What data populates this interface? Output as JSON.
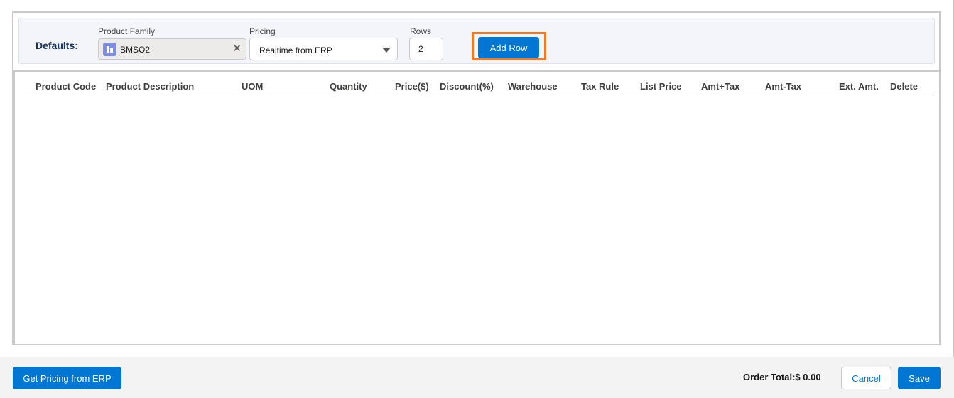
{
  "defaults": {
    "label": "Defaults:",
    "product_family": {
      "label": "Product Family",
      "value": "BMSO2",
      "icon": "product-family-icon",
      "clear_icon": "close-icon"
    },
    "pricing": {
      "label": "Pricing",
      "value": "Realtime from ERP",
      "icon": "chevron-down-icon"
    },
    "rows": {
      "label": "Rows",
      "value": "2"
    },
    "add_row_label": "Add Row"
  },
  "table": {
    "columns": [
      "Product Code",
      "Product Description",
      "UOM",
      "Quantity",
      "Price($)",
      "Discount(%)",
      "Warehouse",
      "Tax Rule",
      "List Price",
      "Amt+Tax",
      "Amt-Tax",
      "Ext. Amt.",
      "Delete"
    ],
    "rows": []
  },
  "footer": {
    "get_pricing_label": "Get Pricing from ERP",
    "order_total": "Order Total:$ 0.00",
    "cancel_label": "Cancel",
    "save_label": "Save"
  },
  "colors": {
    "brand": "#0176d3",
    "highlight": "#f07d26",
    "heading": "#16325c"
  }
}
